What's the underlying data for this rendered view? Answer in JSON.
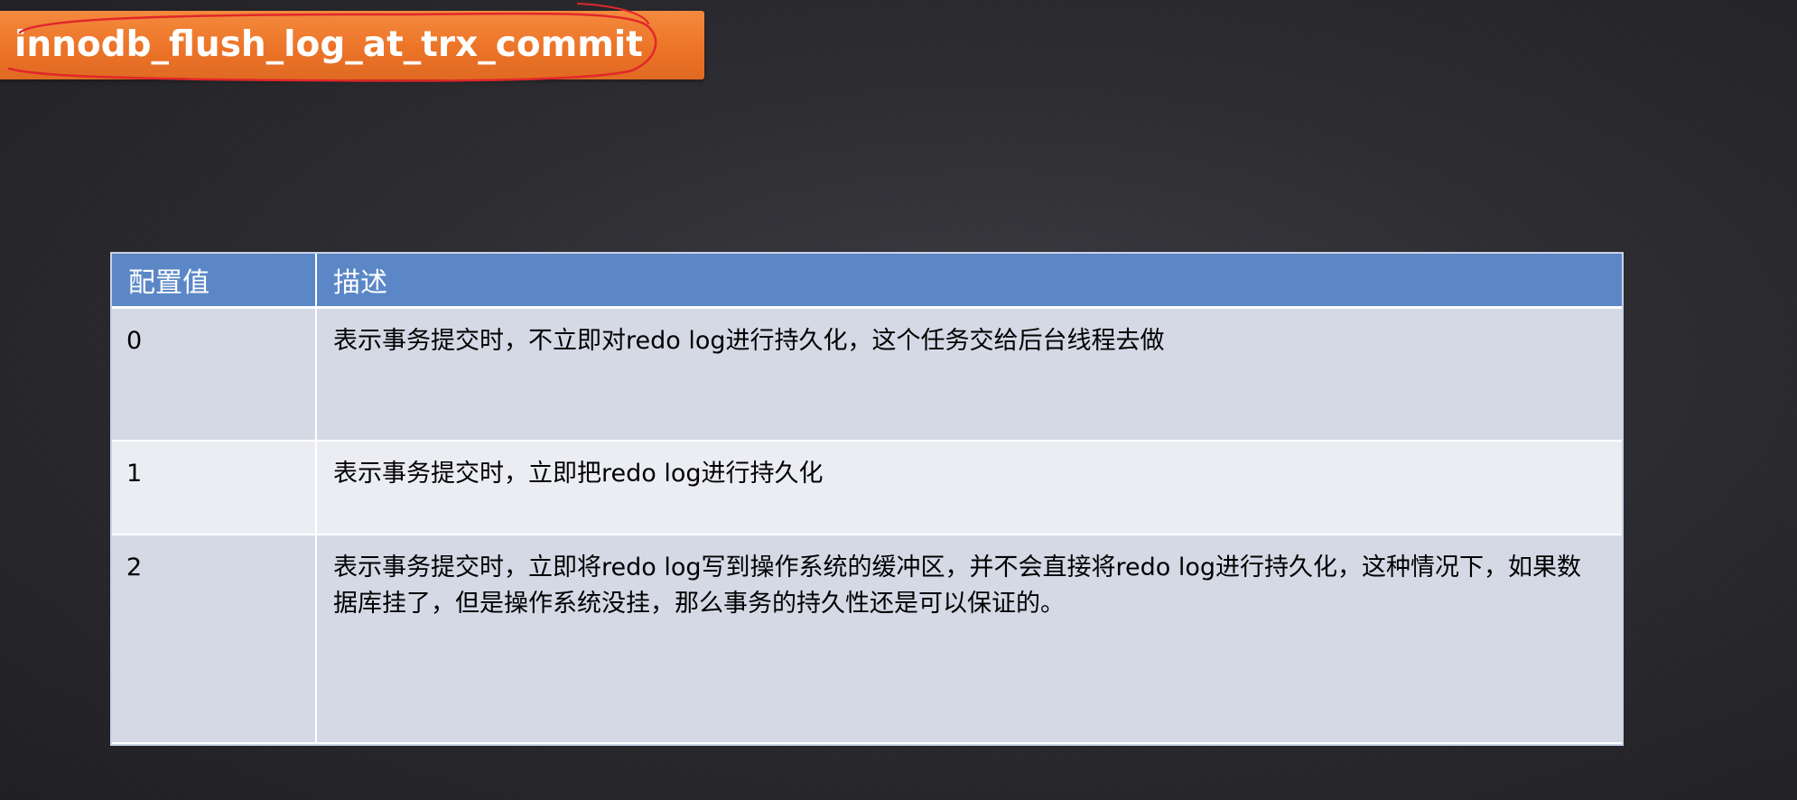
{
  "slide": {
    "title": "innodb_flush_log_at_trx_commit",
    "banner_color": "#ed7d31",
    "annotation_color": "#e0282a"
  },
  "table": {
    "headers": [
      "配置值",
      "描述"
    ],
    "header_color": "#5b87c7",
    "rows": [
      {
        "value": "0",
        "description": "表示事务提交时，不立即对redo log进行持久化，这个任务交给后台线程去做"
      },
      {
        "value": "1",
        "description": "表示事务提交时，立即把redo log进行持久化"
      },
      {
        "value": "2",
        "description": "表示事务提交时，立即将redo log写到操作系统的缓冲区，并不会直接将redo log进行持久化，这种情况下，如果数据库挂了，但是操作系统没挂，那么事务的持久性还是可以保证的。"
      }
    ]
  }
}
